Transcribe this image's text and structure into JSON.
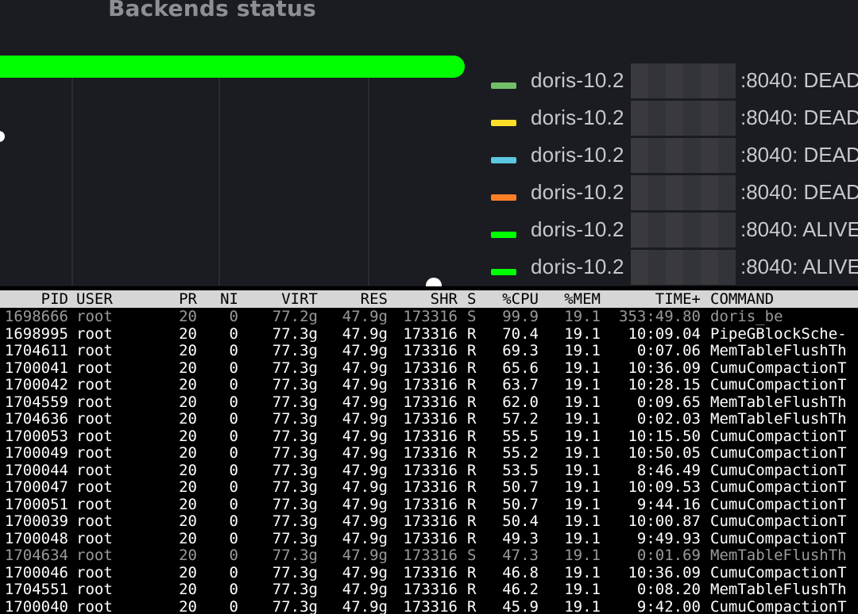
{
  "panel": {
    "title": "Backends status",
    "legend": [
      {
        "prefix": "doris-10.2",
        "suffix": ":8040: DEAD",
        "color": "#73bf69"
      },
      {
        "prefix": "doris-10.2",
        "suffix": ":8040: DEAD",
        "color": "#fade2a"
      },
      {
        "prefix": "doris-10.2",
        "suffix": ":8040: DEAD",
        "color": "#5bc7e0"
      },
      {
        "prefix": "doris-10.2",
        "suffix": ":8040: DEAD",
        "color": "#ff7f27"
      },
      {
        "prefix": "doris-10.2",
        "suffix": ":8040: ALIVE",
        "color": "#00ff00"
      },
      {
        "prefix": "doris-10.2",
        "suffix": ":8040: ALIVE",
        "color": "#00ff00"
      }
    ],
    "status_color": "#00ff00"
  },
  "terminal": {
    "header": {
      "pid": "PID",
      "user": "USER",
      "pr": "PR",
      "ni": "NI",
      "virt": "VIRT",
      "res": "RES",
      "shr": "SHR",
      "s": "S",
      "cpu": "%CPU",
      "mem": "%MEM",
      "time": "TIME+",
      "cmd": "COMMAND"
    },
    "rows": [
      {
        "pid": "1698666",
        "user": "root",
        "pr": "20",
        "ni": "0",
        "virt": "77.2g",
        "res": "47.9g",
        "shr": "173316",
        "s": "S",
        "cpu": "99.9",
        "mem": "19.1",
        "time": "353:49.80",
        "cmd": "doris_be",
        "dim": true
      },
      {
        "pid": "1698995",
        "user": "root",
        "pr": "20",
        "ni": "0",
        "virt": "77.3g",
        "res": "47.9g",
        "shr": "173316",
        "s": "R",
        "cpu": "70.4",
        "mem": "19.1",
        "time": "10:09.04",
        "cmd": "PipeGBlockSche-",
        "dim": false
      },
      {
        "pid": "1704611",
        "user": "root",
        "pr": "20",
        "ni": "0",
        "virt": "77.3g",
        "res": "47.9g",
        "shr": "173316",
        "s": "R",
        "cpu": "69.3",
        "mem": "19.1",
        "time": "0:07.06",
        "cmd": "MemTableFlushTh",
        "dim": false
      },
      {
        "pid": "1700041",
        "user": "root",
        "pr": "20",
        "ni": "0",
        "virt": "77.3g",
        "res": "47.9g",
        "shr": "173316",
        "s": "R",
        "cpu": "65.6",
        "mem": "19.1",
        "time": "10:36.09",
        "cmd": "CumuCompactionT",
        "dim": false
      },
      {
        "pid": "1700042",
        "user": "root",
        "pr": "20",
        "ni": "0",
        "virt": "77.3g",
        "res": "47.9g",
        "shr": "173316",
        "s": "R",
        "cpu": "63.7",
        "mem": "19.1",
        "time": "10:28.15",
        "cmd": "CumuCompactionT",
        "dim": false
      },
      {
        "pid": "1704559",
        "user": "root",
        "pr": "20",
        "ni": "0",
        "virt": "77.3g",
        "res": "47.9g",
        "shr": "173316",
        "s": "R",
        "cpu": "62.0",
        "mem": "19.1",
        "time": "0:09.65",
        "cmd": "MemTableFlushTh",
        "dim": false
      },
      {
        "pid": "1704636",
        "user": "root",
        "pr": "20",
        "ni": "0",
        "virt": "77.3g",
        "res": "47.9g",
        "shr": "173316",
        "s": "R",
        "cpu": "57.2",
        "mem": "19.1",
        "time": "0:02.03",
        "cmd": "MemTableFlushTh",
        "dim": false
      },
      {
        "pid": "1700053",
        "user": "root",
        "pr": "20",
        "ni": "0",
        "virt": "77.3g",
        "res": "47.9g",
        "shr": "173316",
        "s": "R",
        "cpu": "55.5",
        "mem": "19.1",
        "time": "10:15.50",
        "cmd": "CumuCompactionT",
        "dim": false
      },
      {
        "pid": "1700049",
        "user": "root",
        "pr": "20",
        "ni": "0",
        "virt": "77.3g",
        "res": "47.9g",
        "shr": "173316",
        "s": "R",
        "cpu": "55.2",
        "mem": "19.1",
        "time": "10:50.05",
        "cmd": "CumuCompactionT",
        "dim": false
      },
      {
        "pid": "1700044",
        "user": "root",
        "pr": "20",
        "ni": "0",
        "virt": "77.3g",
        "res": "47.9g",
        "shr": "173316",
        "s": "R",
        "cpu": "53.5",
        "mem": "19.1",
        "time": "8:46.49",
        "cmd": "CumuCompactionT",
        "dim": false
      },
      {
        "pid": "1700047",
        "user": "root",
        "pr": "20",
        "ni": "0",
        "virt": "77.3g",
        "res": "47.9g",
        "shr": "173316",
        "s": "R",
        "cpu": "50.7",
        "mem": "19.1",
        "time": "10:09.53",
        "cmd": "CumuCompactionT",
        "dim": false
      },
      {
        "pid": "1700051",
        "user": "root",
        "pr": "20",
        "ni": "0",
        "virt": "77.3g",
        "res": "47.9g",
        "shr": "173316",
        "s": "R",
        "cpu": "50.7",
        "mem": "19.1",
        "time": "9:44.16",
        "cmd": "CumuCompactionT",
        "dim": false
      },
      {
        "pid": "1700039",
        "user": "root",
        "pr": "20",
        "ni": "0",
        "virt": "77.3g",
        "res": "47.9g",
        "shr": "173316",
        "s": "R",
        "cpu": "50.4",
        "mem": "19.1",
        "time": "10:00.87",
        "cmd": "CumuCompactionT",
        "dim": false
      },
      {
        "pid": "1700048",
        "user": "root",
        "pr": "20",
        "ni": "0",
        "virt": "77.3g",
        "res": "47.9g",
        "shr": "173316",
        "s": "R",
        "cpu": "49.3",
        "mem": "19.1",
        "time": "9:49.93",
        "cmd": "CumuCompactionT",
        "dim": false
      },
      {
        "pid": "1704634",
        "user": "root",
        "pr": "20",
        "ni": "0",
        "virt": "77.3g",
        "res": "47.9g",
        "shr": "173316",
        "s": "S",
        "cpu": "47.3",
        "mem": "19.1",
        "time": "0:01.69",
        "cmd": "MemTableFlushTh",
        "dim": true
      },
      {
        "pid": "1700046",
        "user": "root",
        "pr": "20",
        "ni": "0",
        "virt": "77.3g",
        "res": "47.9g",
        "shr": "173316",
        "s": "R",
        "cpu": "46.8",
        "mem": "19.1",
        "time": "10:36.09",
        "cmd": "CumuCompactionT",
        "dim": false
      },
      {
        "pid": "1704551",
        "user": "root",
        "pr": "20",
        "ni": "0",
        "virt": "77.3g",
        "res": "47.9g",
        "shr": "173316",
        "s": "R",
        "cpu": "46.2",
        "mem": "19.1",
        "time": "0:08.20",
        "cmd": "MemTableFlushTh",
        "dim": false
      },
      {
        "pid": "1700040",
        "user": "root",
        "pr": "20",
        "ni": "0",
        "virt": "77.3g",
        "res": "47.9g",
        "shr": "173316",
        "s": "R",
        "cpu": "45.9",
        "mem": "19.1",
        "time": "9:42.00",
        "cmd": "CumuCompactionT",
        "dim": false
      }
    ]
  }
}
